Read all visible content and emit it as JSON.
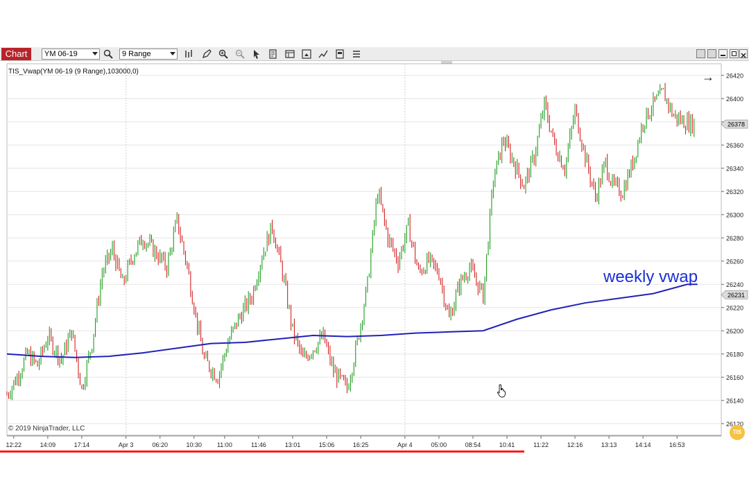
{
  "toolbar": {
    "chart_tab": "Chart",
    "instrument": "YM 06-19",
    "period": "9 Range"
  },
  "chart": {
    "title": "TIS_Vwap(YM 06-19 (9 Range),103000,0)",
    "copyright": "© 2019 NinjaTrader, LLC",
    "annotation": "weekly vwap",
    "badge": "TIS",
    "nav_arrow": "→",
    "current_price_label": "26378",
    "vwap_price_label": "26231",
    "colors": {
      "up_bar": "#1e9c1e",
      "down_bar": "#d42020",
      "vwap_line": "#2020b8",
      "grid": "#e6e6e6",
      "annotation": "#1a2ed8",
      "progress": "#ff1a1a"
    },
    "video_progress": 0.7
  },
  "chart_data": {
    "type": "line",
    "title": "TIS_Vwap(YM 06-19 (9 Range),103000,0)",
    "ylim": [
      26110,
      26430
    ],
    "y_ticks": [
      26420,
      26400,
      26380,
      26360,
      26340,
      26320,
      26300,
      26280,
      26260,
      26240,
      26220,
      26200,
      26180,
      26160,
      26140,
      26120
    ],
    "x_ticks": [
      "12:22",
      "14:09",
      "17:14",
      "Apr 3",
      "06:20",
      "10:30",
      "11:00",
      "11:46",
      "13:01",
      "15:06",
      "16:25",
      "Apr 4",
      "05:00",
      "08:54",
      "10:41",
      "11:22",
      "12:16",
      "13:13",
      "14:14",
      "16:53"
    ],
    "x_tick_index": [
      2,
      12,
      22,
      35,
      45,
      55,
      64,
      74,
      84,
      94,
      104,
      117,
      127,
      137,
      147,
      157,
      167,
      177,
      187,
      197
    ],
    "x_range": [
      0,
      210
    ],
    "day_separators": [
      35,
      117
    ],
    "series": [
      {
        "name": "weekly vwap",
        "x": [
          0,
          10,
          20,
          30,
          40,
          50,
          60,
          70,
          80,
          90,
          100,
          110,
          120,
          130,
          140,
          150,
          160,
          170,
          180,
          190,
          200,
          203
        ],
        "values": [
          26180,
          26178,
          26177,
          26178,
          26181,
          26185,
          26189,
          26190,
          26193,
          26196,
          26195,
          26196,
          26198,
          26199,
          26200,
          26210,
          26218,
          26224,
          26228,
          26232,
          26240,
          26240
        ]
      },
      {
        "name": "price",
        "x": [
          0,
          3,
          6,
          9,
          12,
          16,
          19,
          22,
          25,
          28,
          31,
          34,
          37,
          40,
          43,
          47,
          50,
          53,
          56,
          58,
          62,
          65,
          68,
          72,
          75,
          78,
          81,
          84,
          87,
          90,
          93,
          96,
          100,
          103,
          106,
          109,
          112,
          115,
          118,
          121,
          124,
          127,
          130,
          133,
          136,
          140,
          143,
          146,
          149,
          152,
          155,
          158,
          161,
          164,
          167,
          170,
          173,
          176,
          178,
          181,
          184,
          187,
          190,
          193,
          196,
          199,
          202
        ],
        "values": [
          26145,
          26160,
          26180,
          26170,
          26195,
          26175,
          26200,
          26150,
          26190,
          26250,
          26270,
          26240,
          26265,
          26280,
          26270,
          26255,
          26295,
          26255,
          26205,
          26175,
          26160,
          26190,
          26210,
          26230,
          26265,
          26290,
          26250,
          26200,
          26175,
          26185,
          26195,
          26165,
          26150,
          26190,
          26240,
          26320,
          26280,
          26260,
          26290,
          26250,
          26260,
          26250,
          26210,
          26240,
          26255,
          26230,
          26330,
          26365,
          26345,
          26325,
          26350,
          26395,
          26360,
          26340,
          26390,
          26350,
          26315,
          26345,
          26325,
          26320,
          26345,
          26380,
          26395,
          26405,
          26385,
          26380,
          26378
        ]
      }
    ]
  }
}
